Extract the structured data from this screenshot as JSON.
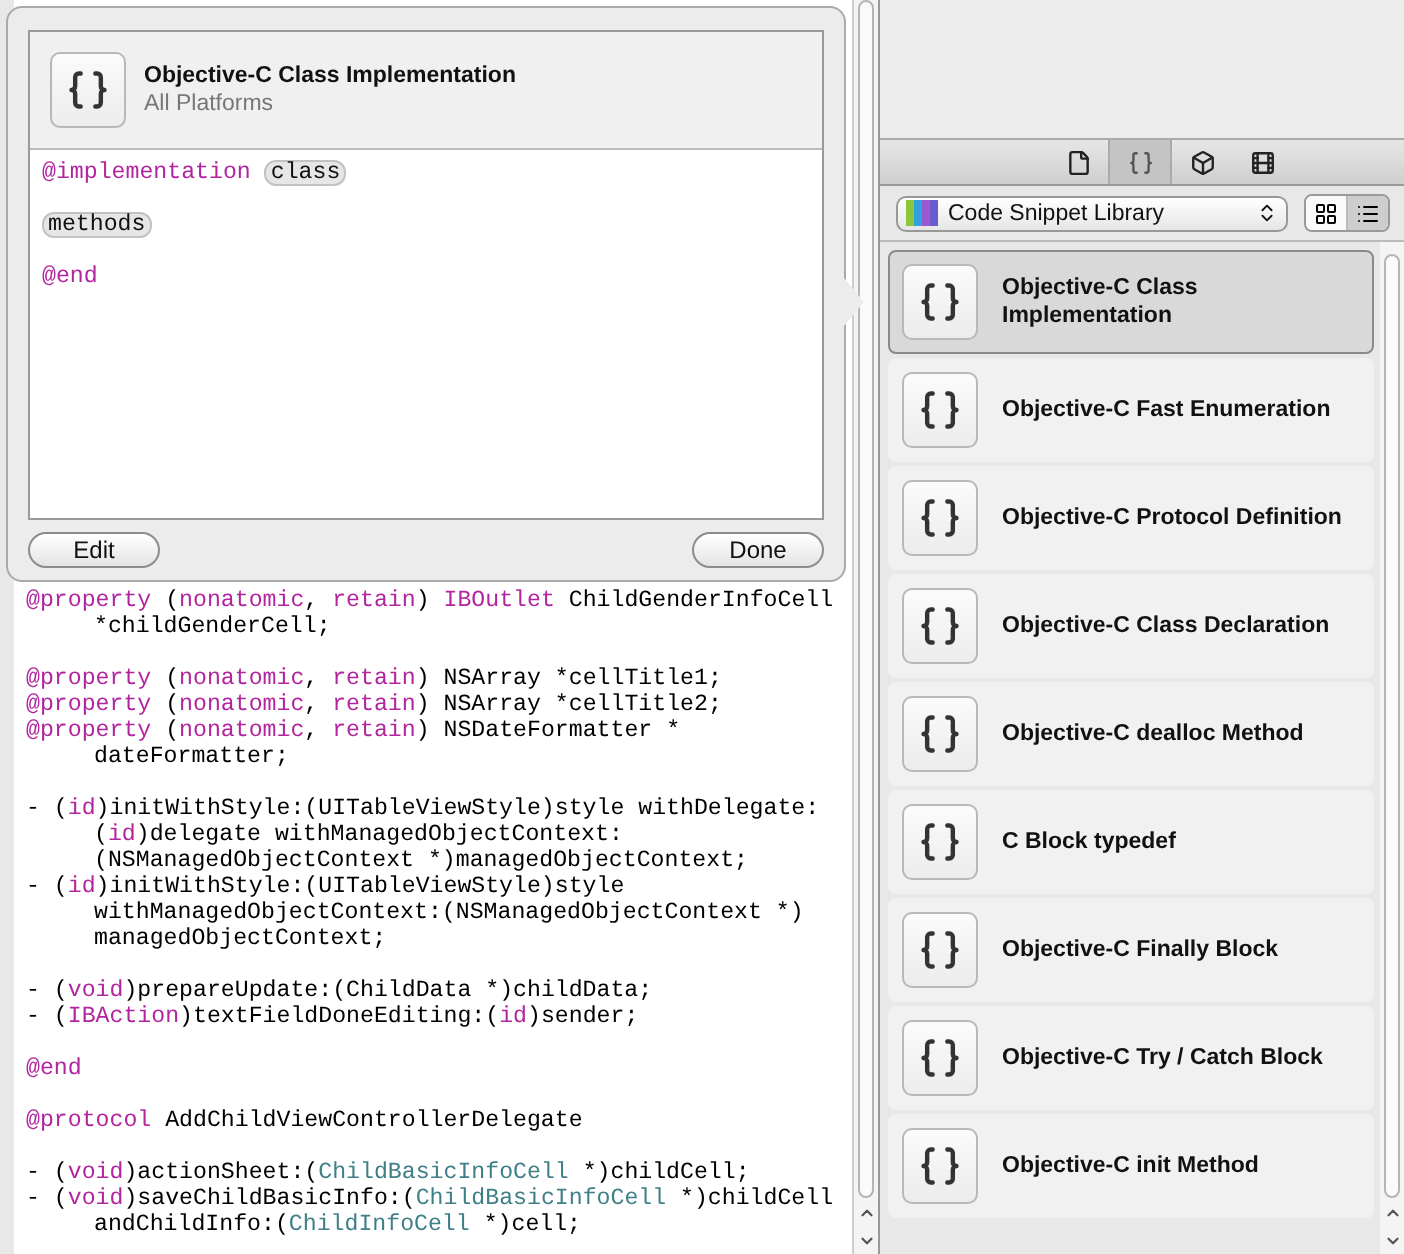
{
  "popover": {
    "title": "Objective-C Class Implementation",
    "subtitle": "All Platforms",
    "snippet_lines": [
      {
        "kind": "code",
        "tokens": [
          {
            "text": "@implementation",
            "kind": "keyword"
          },
          {
            "text": "class",
            "kind": "placeholder"
          }
        ]
      },
      {
        "kind": "blank"
      },
      {
        "kind": "code",
        "tokens": [
          {
            "text": "methods",
            "kind": "placeholder"
          }
        ]
      },
      {
        "kind": "blank"
      },
      {
        "kind": "code",
        "tokens": [
          {
            "text": "@end",
            "kind": "keyword"
          }
        ]
      }
    ],
    "buttons": [
      {
        "label": "Edit"
      },
      {
        "label": "Done"
      }
    ]
  },
  "editor": {
    "lines": [
      {
        "kind": "code",
        "indent": false,
        "tokens": [
          {
            "text": "@property",
            "kind": "keyword"
          },
          {
            "text": " (",
            "kind": "plain"
          },
          {
            "text": "nonatomic",
            "kind": "keyword"
          },
          {
            "text": ", ",
            "kind": "plain"
          },
          {
            "text": "retain",
            "kind": "keyword"
          },
          {
            "text": ") ",
            "kind": "plain"
          },
          {
            "text": "IBOutlet",
            "kind": "keyword"
          },
          {
            "text": " ChildGenderInfoCell",
            "kind": "plain"
          }
        ]
      },
      {
        "kind": "code",
        "indent": true,
        "tokens": [
          {
            "text": "*childGenderCell;",
            "kind": "plain"
          }
        ]
      },
      {
        "kind": "blank"
      },
      {
        "kind": "code",
        "indent": false,
        "tokens": [
          {
            "text": "@property",
            "kind": "keyword"
          },
          {
            "text": " (",
            "kind": "plain"
          },
          {
            "text": "nonatomic",
            "kind": "keyword"
          },
          {
            "text": ", ",
            "kind": "plain"
          },
          {
            "text": "retain",
            "kind": "keyword"
          },
          {
            "text": ") NSArray *cellTitle1;",
            "kind": "plain"
          }
        ]
      },
      {
        "kind": "code",
        "indent": false,
        "tokens": [
          {
            "text": "@property",
            "kind": "keyword"
          },
          {
            "text": " (",
            "kind": "plain"
          },
          {
            "text": "nonatomic",
            "kind": "keyword"
          },
          {
            "text": ", ",
            "kind": "plain"
          },
          {
            "text": "retain",
            "kind": "keyword"
          },
          {
            "text": ") NSArray *cellTitle2;",
            "kind": "plain"
          }
        ]
      },
      {
        "kind": "code",
        "indent": false,
        "tokens": [
          {
            "text": "@property",
            "kind": "keyword"
          },
          {
            "text": " (",
            "kind": "plain"
          },
          {
            "text": "nonatomic",
            "kind": "keyword"
          },
          {
            "text": ", ",
            "kind": "plain"
          },
          {
            "text": "retain",
            "kind": "keyword"
          },
          {
            "text": ") NSDateFormatter *",
            "kind": "plain"
          }
        ]
      },
      {
        "kind": "code",
        "indent": true,
        "tokens": [
          {
            "text": "dateFormatter;",
            "kind": "plain"
          }
        ]
      },
      {
        "kind": "blank"
      },
      {
        "kind": "code",
        "indent": false,
        "tokens": [
          {
            "text": "- (",
            "kind": "plain"
          },
          {
            "text": "id",
            "kind": "keyword"
          },
          {
            "text": ")initWithStyle:(UITableViewStyle)style withDelegate:",
            "kind": "plain"
          }
        ]
      },
      {
        "kind": "code",
        "indent": true,
        "tokens": [
          {
            "text": "(",
            "kind": "plain"
          },
          {
            "text": "id",
            "kind": "keyword"
          },
          {
            "text": ")delegate withManagedObjectContext:",
            "kind": "plain"
          }
        ]
      },
      {
        "kind": "code",
        "indent": true,
        "tokens": [
          {
            "text": "(NSManagedObjectContext *)managedObjectContext;",
            "kind": "plain"
          }
        ]
      },
      {
        "kind": "code",
        "indent": false,
        "tokens": [
          {
            "text": "- (",
            "kind": "plain"
          },
          {
            "text": "id",
            "kind": "keyword"
          },
          {
            "text": ")initWithStyle:(UITableViewStyle)style",
            "kind": "plain"
          }
        ]
      },
      {
        "kind": "code",
        "indent": true,
        "tokens": [
          {
            "text": "withManagedObjectContext:(NSManagedObjectContext *)",
            "kind": "plain"
          }
        ]
      },
      {
        "kind": "code",
        "indent": true,
        "tokens": [
          {
            "text": "managedObjectContext;",
            "kind": "plain"
          }
        ]
      },
      {
        "kind": "blank"
      },
      {
        "kind": "code",
        "indent": false,
        "tokens": [
          {
            "text": "- (",
            "kind": "plain"
          },
          {
            "text": "void",
            "kind": "keyword"
          },
          {
            "text": ")prepareUpdate:(ChildData *)childData;",
            "kind": "plain"
          }
        ]
      },
      {
        "kind": "code",
        "indent": false,
        "tokens": [
          {
            "text": "- (",
            "kind": "plain"
          },
          {
            "text": "IBAction",
            "kind": "keyword"
          },
          {
            "text": ")textFieldDoneEditing:(",
            "kind": "plain"
          },
          {
            "text": "id",
            "kind": "keyword"
          },
          {
            "text": ")sender;",
            "kind": "plain"
          }
        ]
      },
      {
        "kind": "blank"
      },
      {
        "kind": "code",
        "indent": false,
        "tokens": [
          {
            "text": "@end",
            "kind": "keyword"
          }
        ]
      },
      {
        "kind": "blank"
      },
      {
        "kind": "code",
        "indent": false,
        "tokens": [
          {
            "text": "@protocol",
            "kind": "keyword"
          },
          {
            "text": " AddChildViewControllerDelegate",
            "kind": "plain"
          }
        ]
      },
      {
        "kind": "blank"
      },
      {
        "kind": "code",
        "indent": false,
        "tokens": [
          {
            "text": "- (",
            "kind": "plain"
          },
          {
            "text": "void",
            "kind": "keyword"
          },
          {
            "text": ")actionSheet:(",
            "kind": "plain"
          },
          {
            "text": "ChildBasicInfoCell",
            "kind": "type"
          },
          {
            "text": " *)childCell;",
            "kind": "plain"
          }
        ]
      },
      {
        "kind": "code",
        "indent": false,
        "tokens": [
          {
            "text": "- (",
            "kind": "plain"
          },
          {
            "text": "void",
            "kind": "keyword"
          },
          {
            "text": ")saveChildBasicInfo:(",
            "kind": "plain"
          },
          {
            "text": "ChildBasicInfoCell",
            "kind": "type"
          },
          {
            "text": " *)childCell",
            "kind": "plain"
          }
        ]
      },
      {
        "kind": "code",
        "indent": true,
        "tokens": [
          {
            "text": "andChildInfo:(",
            "kind": "plain"
          },
          {
            "text": "ChildInfoCell",
            "kind": "type"
          },
          {
            "text": " *)cell;",
            "kind": "plain"
          }
        ]
      }
    ]
  },
  "library": {
    "tabs": [
      {
        "kind": "file",
        "selected": false
      },
      {
        "kind": "braces",
        "selected": true
      },
      {
        "kind": "cube",
        "selected": false
      },
      {
        "kind": "film",
        "selected": false
      }
    ],
    "popup": {
      "value": "Code Snippet Library"
    },
    "view_modes": [
      {
        "kind": "grid",
        "selected": false
      },
      {
        "kind": "list",
        "selected": true
      }
    ],
    "items": [
      {
        "title": "Objective-C Class Implementation",
        "selected": true
      },
      {
        "title": "Objective-C Fast Enumeration",
        "selected": false
      },
      {
        "title": "Objective-C Protocol Definition",
        "selected": false
      },
      {
        "title": "Objective-C Class Declaration",
        "selected": false
      },
      {
        "title": "Objective-C dealloc Method",
        "selected": false
      },
      {
        "title": "C Block typedef",
        "selected": false
      },
      {
        "title": "Objective-C Finally Block",
        "selected": false
      },
      {
        "title": "Objective-C Try / Catch Block",
        "selected": false
      },
      {
        "title": "Objective-C init Method",
        "selected": false
      }
    ]
  }
}
